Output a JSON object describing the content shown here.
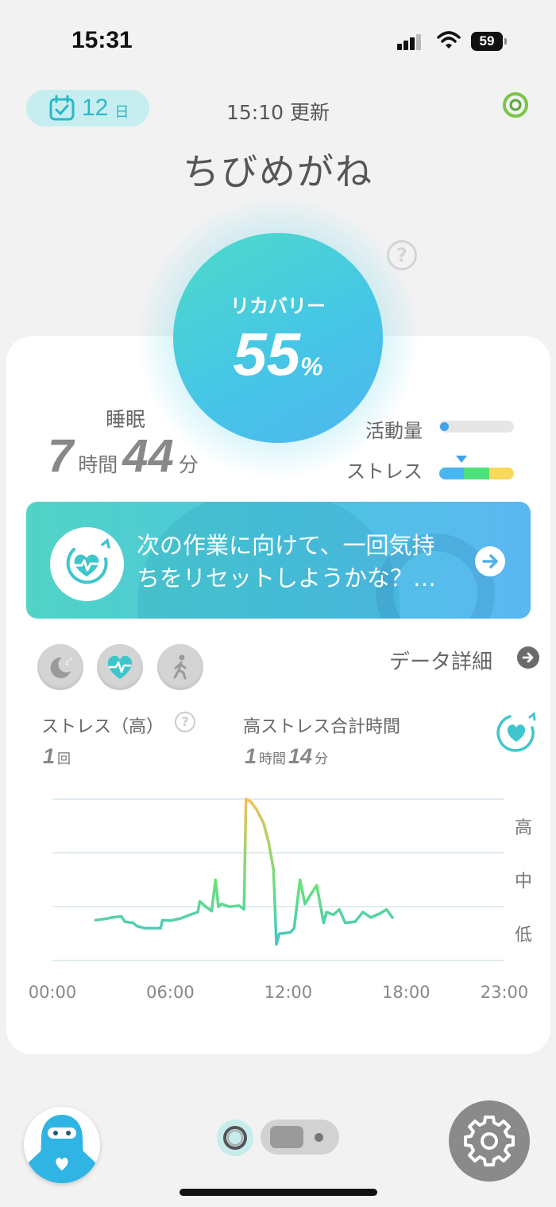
{
  "status_bar": {
    "time": "15:31",
    "battery": "59"
  },
  "header": {
    "day_count": "12",
    "day_unit": "日",
    "updated_text": "15:10 更新",
    "user_name": "ちびめがね"
  },
  "recovery": {
    "label": "リカバリー",
    "value": "55",
    "unit": "%",
    "help": "?"
  },
  "sleep": {
    "label": "睡眠",
    "hours": "7",
    "hours_unit": "時間",
    "minutes": "44",
    "minutes_unit": "分"
  },
  "activity": {
    "label": "活動量",
    "level": 0.05
  },
  "stress": {
    "label": "ストレス",
    "segment_colors": [
      "#4ab6f0",
      "#4ee07a",
      "#f8d85a"
    ],
    "level": 0.2
  },
  "banner": {
    "line1": "次の作業に向けて、一回気持",
    "line2": "ちをリセットしようかな？…"
  },
  "tabs": [
    {
      "name": "sleep",
      "icon": "moon-icon"
    },
    {
      "name": "stress",
      "icon": "heart-pulse-icon"
    },
    {
      "name": "activity",
      "icon": "walk-icon"
    }
  ],
  "data_detail_label": "データ詳細",
  "metrics": {
    "high_stress_label": "ストレス（高）",
    "high_stress_count": "1",
    "high_stress_count_unit": "回",
    "total_label": "高ストレス合計時間",
    "total_hours": "1",
    "total_hours_unit": "時間",
    "total_minutes": "14",
    "total_minutes_unit": "分",
    "help": "?"
  },
  "chart_data": {
    "type": "line",
    "x_ticks": [
      "00:00",
      "06:00",
      "12:00",
      "18:00",
      "23:00"
    ],
    "y_levels": [
      "高",
      "中",
      "低"
    ],
    "x_range_hours": [
      0,
      23
    ],
    "y_range": [
      0,
      3
    ],
    "points": [
      [
        2.2,
        0.75
      ],
      [
        2.8,
        0.78
      ],
      [
        3.0,
        0.8
      ],
      [
        3.5,
        0.82
      ],
      [
        3.7,
        0.72
      ],
      [
        4.1,
        0.7
      ],
      [
        4.3,
        0.64
      ],
      [
        4.7,
        0.6
      ],
      [
        5.2,
        0.6
      ],
      [
        5.5,
        0.6
      ],
      [
        5.6,
        0.75
      ],
      [
        6.0,
        0.74
      ],
      [
        6.5,
        0.78
      ],
      [
        7.0,
        0.85
      ],
      [
        7.4,
        0.9
      ],
      [
        7.5,
        1.1
      ],
      [
        7.8,
        1.0
      ],
      [
        8.1,
        0.92
      ],
      [
        8.3,
        1.5
      ],
      [
        8.45,
        1.0
      ],
      [
        8.6,
        1.05
      ],
      [
        9.0,
        1.0
      ],
      [
        9.5,
        1.02
      ],
      [
        9.75,
        0.95
      ],
      [
        9.85,
        3.0
      ],
      [
        10.1,
        2.95
      ],
      [
        10.4,
        2.8
      ],
      [
        10.75,
        2.55
      ],
      [
        11.0,
        2.2
      ],
      [
        11.25,
        1.7
      ],
      [
        11.4,
        0.3
      ],
      [
        11.55,
        0.5
      ],
      [
        12.1,
        0.52
      ],
      [
        12.3,
        0.6
      ],
      [
        12.6,
        1.5
      ],
      [
        12.85,
        1.05
      ],
      [
        13.1,
        1.2
      ],
      [
        13.45,
        1.4
      ],
      [
        13.65,
        1.0
      ],
      [
        13.8,
        0.7
      ],
      [
        13.95,
        0.9
      ],
      [
        14.3,
        0.85
      ],
      [
        14.6,
        0.95
      ],
      [
        14.9,
        0.7
      ],
      [
        15.4,
        0.72
      ],
      [
        15.8,
        0.9
      ],
      [
        16.2,
        0.8
      ],
      [
        16.7,
        0.88
      ],
      [
        17.0,
        0.95
      ],
      [
        17.3,
        0.8
      ]
    ],
    "gradient_colors": {
      "low": "#3ebde0",
      "mid": "#67e07e",
      "high": "#f2c053"
    }
  }
}
